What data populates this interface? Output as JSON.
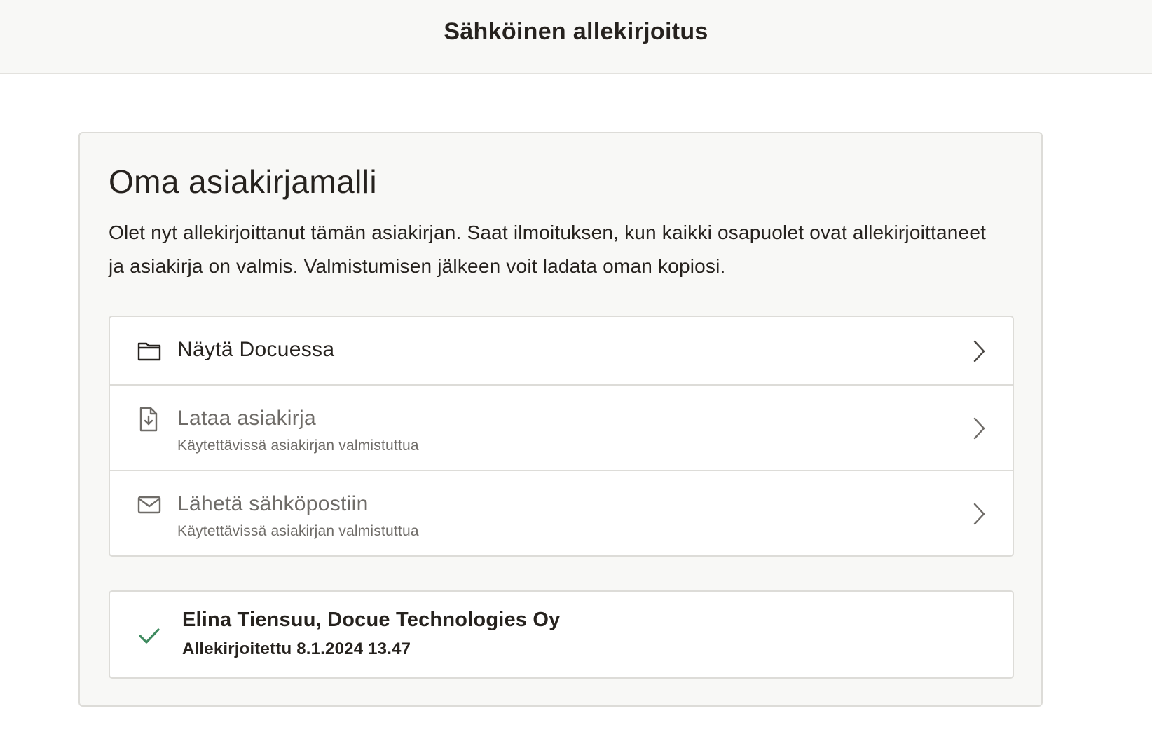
{
  "header": {
    "title": "Sähköinen allekirjoitus"
  },
  "card": {
    "title": "Oma asiakirjamalli",
    "description": "Olet nyt allekirjoittanut tämän asiakirjan. Saat ilmoituksen, kun kaikki osapuolet ovat allekirjoittaneet ja asiakirja on valmis. Valmistumisen jälkeen voit ladata oman kopiosi."
  },
  "actions": [
    {
      "label": "Näytä Docuessa",
      "icon": "folder-icon",
      "enabled": true
    },
    {
      "label": "Lataa asiakirja",
      "sublabel": "Käytettävissä asiakirjan valmistuttua",
      "icon": "file-download-icon",
      "enabled": false
    },
    {
      "label": "Lähetä sähköpostiin",
      "sublabel": "Käytettävissä asiakirjan valmistuttua",
      "icon": "mail-icon",
      "enabled": false
    }
  ],
  "signer": {
    "name": "Elina Tiensuu, Docue Technologies Oy",
    "status": "Allekirjoitettu 8.1.2024 13.47",
    "icon": "check-icon"
  },
  "colors": {
    "text": "#26221e",
    "muted": "#6f6c68",
    "border": "#dddcd8",
    "panel": "#f8f8f6",
    "check": "#3e8a5f"
  }
}
